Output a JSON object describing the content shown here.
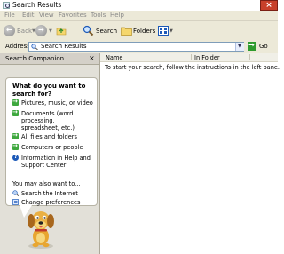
{
  "window": {
    "title": "Search Results"
  },
  "menu": [
    "File",
    "Edit",
    "View",
    "Favorites",
    "Tools",
    "Help"
  ],
  "toolbar": {
    "back_label": "Back",
    "search_label": "Search",
    "folders_label": "Folders"
  },
  "address": {
    "label": "Address",
    "value": "Search Results",
    "go_label": "Go"
  },
  "companion": {
    "title": "Search Companion",
    "question": "What do you want to search for?",
    "options": [
      "Pictures, music, or video",
      "Documents (word processing, spreadsheet, etc.)",
      "All files and folders",
      "Computers or people",
      "Information in Help and Support Center"
    ],
    "also_label": "You may also want to...",
    "also_options": [
      "Search the Internet",
      "Change preferences"
    ]
  },
  "results": {
    "columns": [
      "Name",
      "In Folder"
    ],
    "hint": "To start your search, follow the instructions in the left pane."
  },
  "colors": {
    "titlebar_close": "#c8402a",
    "chrome": "#ece9d8",
    "go_green": "#2e9b2e",
    "arrow_green": "#3ea83e"
  }
}
